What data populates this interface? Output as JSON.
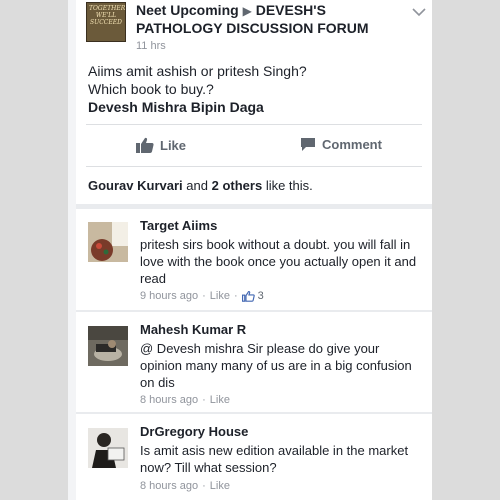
{
  "post": {
    "group_avatar_text": "TOGETHER WE'LL SUCCEED",
    "author": "Neet Upcoming",
    "arrow": "▶",
    "group": "DEVESH'S PATHOLOGY DISCUSSION FORUM",
    "time": "11 hrs",
    "line1": "Aiims amit ashish or pritesh Singh?",
    "line2": "Which book to buy.?",
    "mentions": "Devesh Mishra Bipin Daga"
  },
  "actions": {
    "like_label": "Like",
    "comment_label": "Comment"
  },
  "likes": {
    "name": "Gourav Kurvari",
    "and": "and",
    "others": "2 others",
    "suffix": "like this."
  },
  "comments": [
    {
      "name": "Target Aiims",
      "text": "pritesh sirs book without a doubt. you will fall in love with the book once you actually open it and read",
      "time": "9 hours ago",
      "dot": "·",
      "like": "Like",
      "dot2": "·",
      "count": "3"
    },
    {
      "name": "Mahesh Kumar R",
      "text": "@ Devesh mishra Sir please do give your opinion  many many of us are in a big confusion on dis",
      "time": "8 hours ago",
      "dot": "·",
      "like": "Like"
    },
    {
      "name": "DrGregory House",
      "text": "Is amit asis new edition available in the market now? Till what session?",
      "time": "8 hours ago",
      "dot": "·",
      "like": "Like"
    }
  ],
  "colors": {
    "secondary_text": "#90949c",
    "action_gray": "#606770",
    "link_blue": "#4267b2",
    "separator": "#e9ebee"
  },
  "icons": [
    "chevron-down-icon",
    "thumbs-up-icon",
    "comment-icon"
  ]
}
